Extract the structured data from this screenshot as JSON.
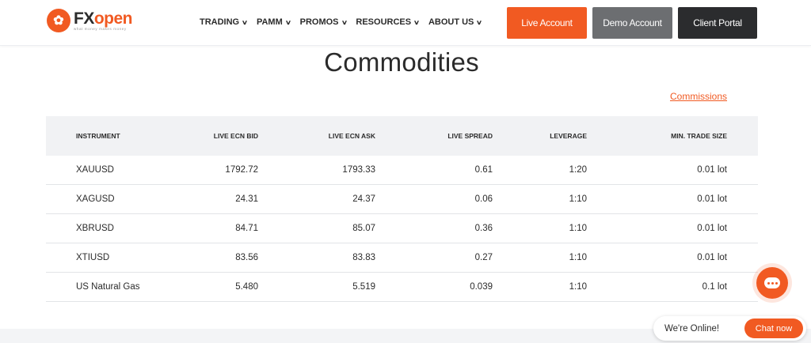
{
  "header": {
    "logo": {
      "text_fx": "FX",
      "text_open": "open",
      "tagline": "what money makes money"
    },
    "nav": [
      {
        "label": "TRADING"
      },
      {
        "label": "PAMM"
      },
      {
        "label": "PROMOS"
      },
      {
        "label": "RESOURCES"
      },
      {
        "label": "ABOUT US"
      }
    ],
    "buttons": {
      "live": "Live Account",
      "demo": "Demo Account",
      "portal": "Client Portal"
    }
  },
  "page": {
    "title": "Commodities",
    "commissions_link": "Commissions"
  },
  "table": {
    "columns": [
      "INSTRUMENT",
      "LIVE ECN BID",
      "LIVE ECN ASK",
      "LIVE SPREAD",
      "LEVERAGE",
      "MIN. TRADE SIZE"
    ],
    "rows": [
      {
        "instrument": "XAUUSD",
        "bid": "1792.72",
        "ask": "1793.33",
        "spread": "0.61",
        "leverage": "1:20",
        "min_size": "0.01 lot"
      },
      {
        "instrument": "XAGUSD",
        "bid": "24.31",
        "ask": "24.37",
        "spread": "0.06",
        "leverage": "1:10",
        "min_size": "0.01 lot"
      },
      {
        "instrument": "XBRUSD",
        "bid": "84.71",
        "ask": "85.07",
        "spread": "0.36",
        "leverage": "1:10",
        "min_size": "0.01 lot"
      },
      {
        "instrument": "XTIUSD",
        "bid": "83.56",
        "ask": "83.83",
        "spread": "0.27",
        "leverage": "1:10",
        "min_size": "0.01 lot"
      },
      {
        "instrument": "US Natural Gas",
        "bid": "5.480",
        "ask": "5.519",
        "spread": "0.039",
        "leverage": "1:10",
        "min_size": "0.1 lot"
      }
    ]
  },
  "chat": {
    "status": "We're Online!",
    "button": "Chat now"
  },
  "colors": {
    "accent": "#f15a22",
    "demo_button": "#6c6e71",
    "portal_button": "#2b2c2e",
    "table_header_bg": "#f1f2f4"
  },
  "icons": {
    "logo": "fxopen-logo-icon",
    "chevron": "chevron-down-icon",
    "chat": "chat-bubble-icon"
  }
}
